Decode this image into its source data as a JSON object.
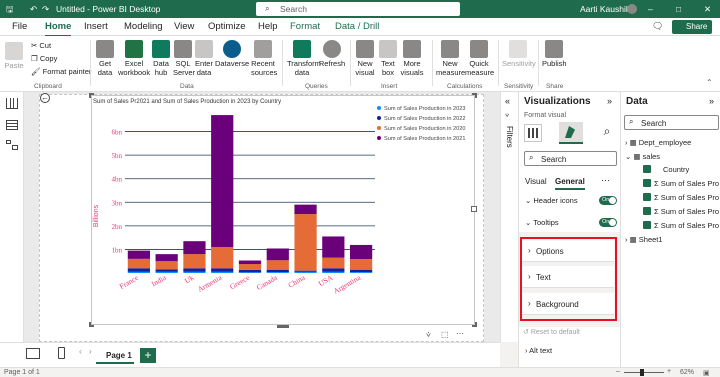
{
  "titlebar": {
    "doc_title": "Untitled - Power BI Desktop",
    "search_placeholder": "Search",
    "user": "Aarti Kaushik"
  },
  "menu": [
    "File",
    "Home",
    "Insert",
    "Modeling",
    "View",
    "Optimize",
    "Help",
    "Format",
    "Data / Drill"
  ],
  "share_label": "Share",
  "ribbon": {
    "clipboard": {
      "paste": "Paste",
      "cut": "Cut",
      "copy": "Copy",
      "format_painter": "Format painter",
      "group": "Clipboard"
    },
    "data": {
      "get_data": "Get data",
      "excel": "Excel workbook",
      "data_hub": "Data hub",
      "sql": "SQL Server",
      "enter": "Enter data",
      "dataverse": "Dataverse",
      "recent": "Recent sources",
      "group": "Data"
    },
    "queries": {
      "transform": "Transform data",
      "refresh": "Refresh",
      "group": "Queries"
    },
    "insert": {
      "new_visual": "New visual",
      "text_box": "Text box",
      "more": "More visuals",
      "group": "Insert"
    },
    "calculations": {
      "new_measure": "New measure",
      "quick": "Quick measure",
      "group": "Calculations"
    },
    "sensitivity": {
      "label": "Sensitivity",
      "group": "Sensitivity"
    },
    "share": {
      "publish": "Publish",
      "group": "Share"
    }
  },
  "chart_data": {
    "type": "bar",
    "title": "Sum of Sales Pr2021 and Sum of Sales Production in 2023 by Country",
    "ylabel": "Billions",
    "y_ticks": [
      "1bn",
      "2bn",
      "3bn",
      "4bn",
      "5bn",
      "6bn"
    ],
    "ylim": [
      0,
      7
    ],
    "categories": [
      "France",
      "India",
      "Uk",
      "Armenia",
      "Greece",
      "Canada",
      "China",
      "USA",
      "Argentina"
    ],
    "series": [
      {
        "name": "Sum of Sales Production in 2023",
        "color": "#118DFF",
        "values": [
          0.05,
          0.05,
          0.05,
          0.05,
          0.03,
          0.04,
          0.05,
          0.05,
          0.04
        ]
      },
      {
        "name": "Sum of Sales Production in 2022",
        "color": "#12239E",
        "values": [
          0.15,
          0.1,
          0.15,
          0.15,
          0.1,
          0.1,
          0.05,
          0.15,
          0.1
        ]
      },
      {
        "name": "Sum of Sales Production in 2020",
        "color": "#E66C37",
        "values": [
          0.4,
          0.35,
          0.6,
          0.9,
          0.25,
          0.4,
          2.4,
          0.45,
          0.45
        ]
      },
      {
        "name": "Sum of Sales Production in 2021",
        "color": "#6B007B",
        "values": [
          0.35,
          0.3,
          0.55,
          5.6,
          0.15,
          0.5,
          0.4,
          0.9,
          0.6
        ]
      }
    ],
    "legend_position": "top-right",
    "grid": true
  },
  "filters_label": "Filters",
  "viz_pane": {
    "title": "Visualizations",
    "format_visual": "Format visual",
    "search": "Search",
    "tab_visual": "Visual",
    "tab_general": "General",
    "header_icons": "Header icons",
    "tooltips": "Tooltips",
    "on": "On",
    "options": "Options",
    "text": "Text",
    "background": "Background",
    "reset": "Reset to default",
    "alt_text": "Alt text"
  },
  "data_pane": {
    "title": "Data",
    "search": "Search",
    "tables": [
      "Dept_employee",
      "sales",
      "Sheet1"
    ],
    "fields": [
      "Country",
      "Sum of Sales Production...",
      "Sum of Sales Production...",
      "Sum of Sales Production...",
      "Sum of Sales Production..."
    ]
  },
  "page_tab": "Page 1",
  "status": {
    "page": "Page 1 of 1",
    "zoom": "62%"
  }
}
